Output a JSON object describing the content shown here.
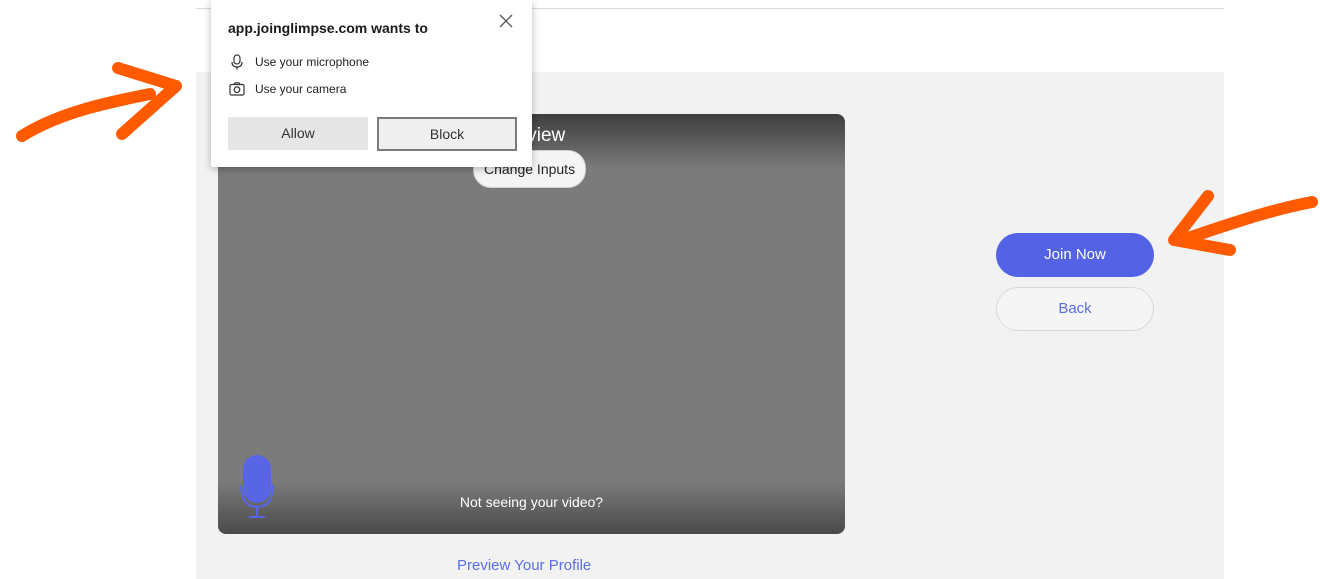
{
  "permission_popup": {
    "title": "app.joinglimpse.com wants to",
    "items": [
      {
        "label": "Use your microphone",
        "icon": "microphone-icon"
      },
      {
        "label": "Use your camera",
        "icon": "camera-icon"
      }
    ],
    "allow_label": "Allow",
    "block_label": "Block",
    "close_icon": "close-icon"
  },
  "preview": {
    "title": "Preview",
    "change_inputs_label": "Change Inputs",
    "not_seeing_label": "Not seeing your video?",
    "mic_icon": "microphone-icon"
  },
  "actions": {
    "join_label": "Join Now",
    "back_label": "Back"
  },
  "profile_link": "Preview Your Profile",
  "annotations": {
    "arrow_color": "#ff5a00"
  },
  "colors": {
    "accent": "#5462e6",
    "link": "#5b6fe0",
    "panel_bg": "#f2f2f2"
  }
}
